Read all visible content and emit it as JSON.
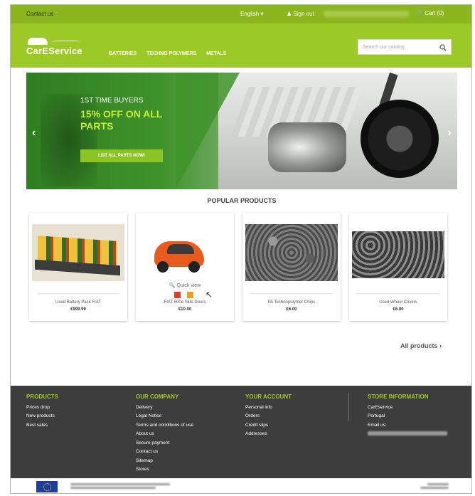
{
  "topbar": {
    "contact": "Contact us",
    "language": "English ▾",
    "signout": "Sign out",
    "cart": "Cart (0)"
  },
  "header": {
    "brand": "CarEService",
    "nav": [
      "BATTERIES",
      "TECHNO POLYMERS",
      "METALS"
    ],
    "search_placeholder": "Search our catalog"
  },
  "hero": {
    "line1": "1ST TIME BUYERS",
    "line2": "15% OFF ON ALL PARTS",
    "cta": "LIST ALL PARTS NOW!",
    "prev": "‹",
    "next": "›"
  },
  "popular": {
    "title": "POPULAR PRODUCTS",
    "quick_view": "Quick view",
    "products": [
      {
        "name": "Used Battery Pack FIAT",
        "price": "€999.99"
      },
      {
        "name": "FIAT 500e Side Doors",
        "price": "€10.00"
      },
      {
        "name": "PA Technopolymer Chips",
        "price": "€6.00"
      },
      {
        "name": "Used Wheel Covers",
        "price": "€6.00"
      }
    ],
    "all_products": "All products ›"
  },
  "footer": {
    "products": {
      "title": "PRODUCTS",
      "items": [
        "Prices drop",
        "New products",
        "Best sales"
      ]
    },
    "company": {
      "title": "OUR COMPANY",
      "items": [
        "Delivery",
        "Legal Notice",
        "Terms and conditions of use",
        "About us",
        "Secure payment",
        "Contact us",
        "Sitemap",
        "Stores"
      ]
    },
    "account": {
      "title": "YOUR ACCOUNT",
      "items": [
        "Personal info",
        "Orders",
        "Credit slips",
        "Addresses"
      ]
    },
    "store": {
      "title": "STORE INFORMATION",
      "name": "CarEservice",
      "country": "Portugal",
      "email_label": "Email us:"
    }
  },
  "colors": {
    "brand_green": "#9cc925",
    "topbar_green": "#8cb61d",
    "footer_bg": "#3d3d3d"
  }
}
